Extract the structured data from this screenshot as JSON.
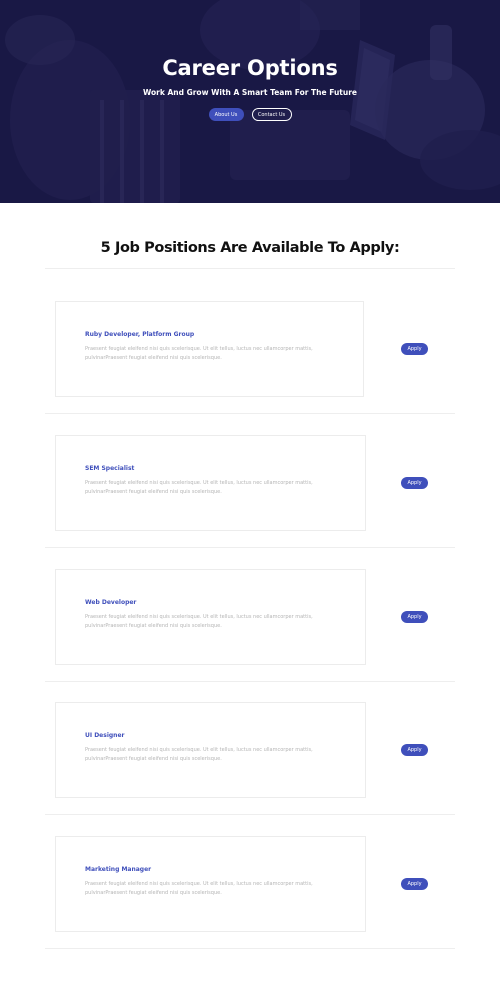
{
  "hero": {
    "title": "Career Options",
    "subtitle": "Work And Grow With A Smart Team For The Future",
    "about_label": "About Us",
    "contact_label": "Contact Us"
  },
  "positions": {
    "heading": "5 Job Positions Are Available To Apply:",
    "jobs": [
      {
        "title": "Ruby Developer, Platform Group",
        "description": "Praesent feugiat eleifend nisi quis scelerisque. Ut elit tellus, luctus nec ullamcorper mattis, pulvinarPraesent feugiat eleifend nisi quis scelerisque.",
        "apply_label": "Apply"
      },
      {
        "title": "SEM Specialist",
        "description": "Praesent feugiat eleifend nisi quis scelerisque. Ut elit tellus, luctus nec ullamcorper mattis, pulvinarPraesent feugiat eleifend nisi quis scelerisque.",
        "apply_label": "Apply"
      },
      {
        "title": "Web Developer",
        "description": "Praesent feugiat eleifend nisi quis scelerisque. Ut elit tellus, luctus nec ullamcorper mattis, pulvinarPraesent feugiat eleifend nisi quis scelerisque.",
        "apply_label": "Apply"
      },
      {
        "title": "UI Designer",
        "description": "Praesent feugiat eleifend nisi quis scelerisque. Ut elit tellus, luctus nec ullamcorper mattis, pulvinarPraesent feugiat eleifend nisi quis scelerisque.",
        "apply_label": "Apply"
      },
      {
        "title": "Marketing Manager",
        "description": "Praesent feugiat eleifend nisi quis scelerisque. Ut elit tellus, luctus nec ullamcorper mattis, pulvinarPraesent feugiat eleifend nisi quis scelerisque.",
        "apply_label": "Apply"
      }
    ]
  },
  "colors": {
    "accent": "#3f4fbb",
    "hero_overlay": "#1e1d4a"
  }
}
